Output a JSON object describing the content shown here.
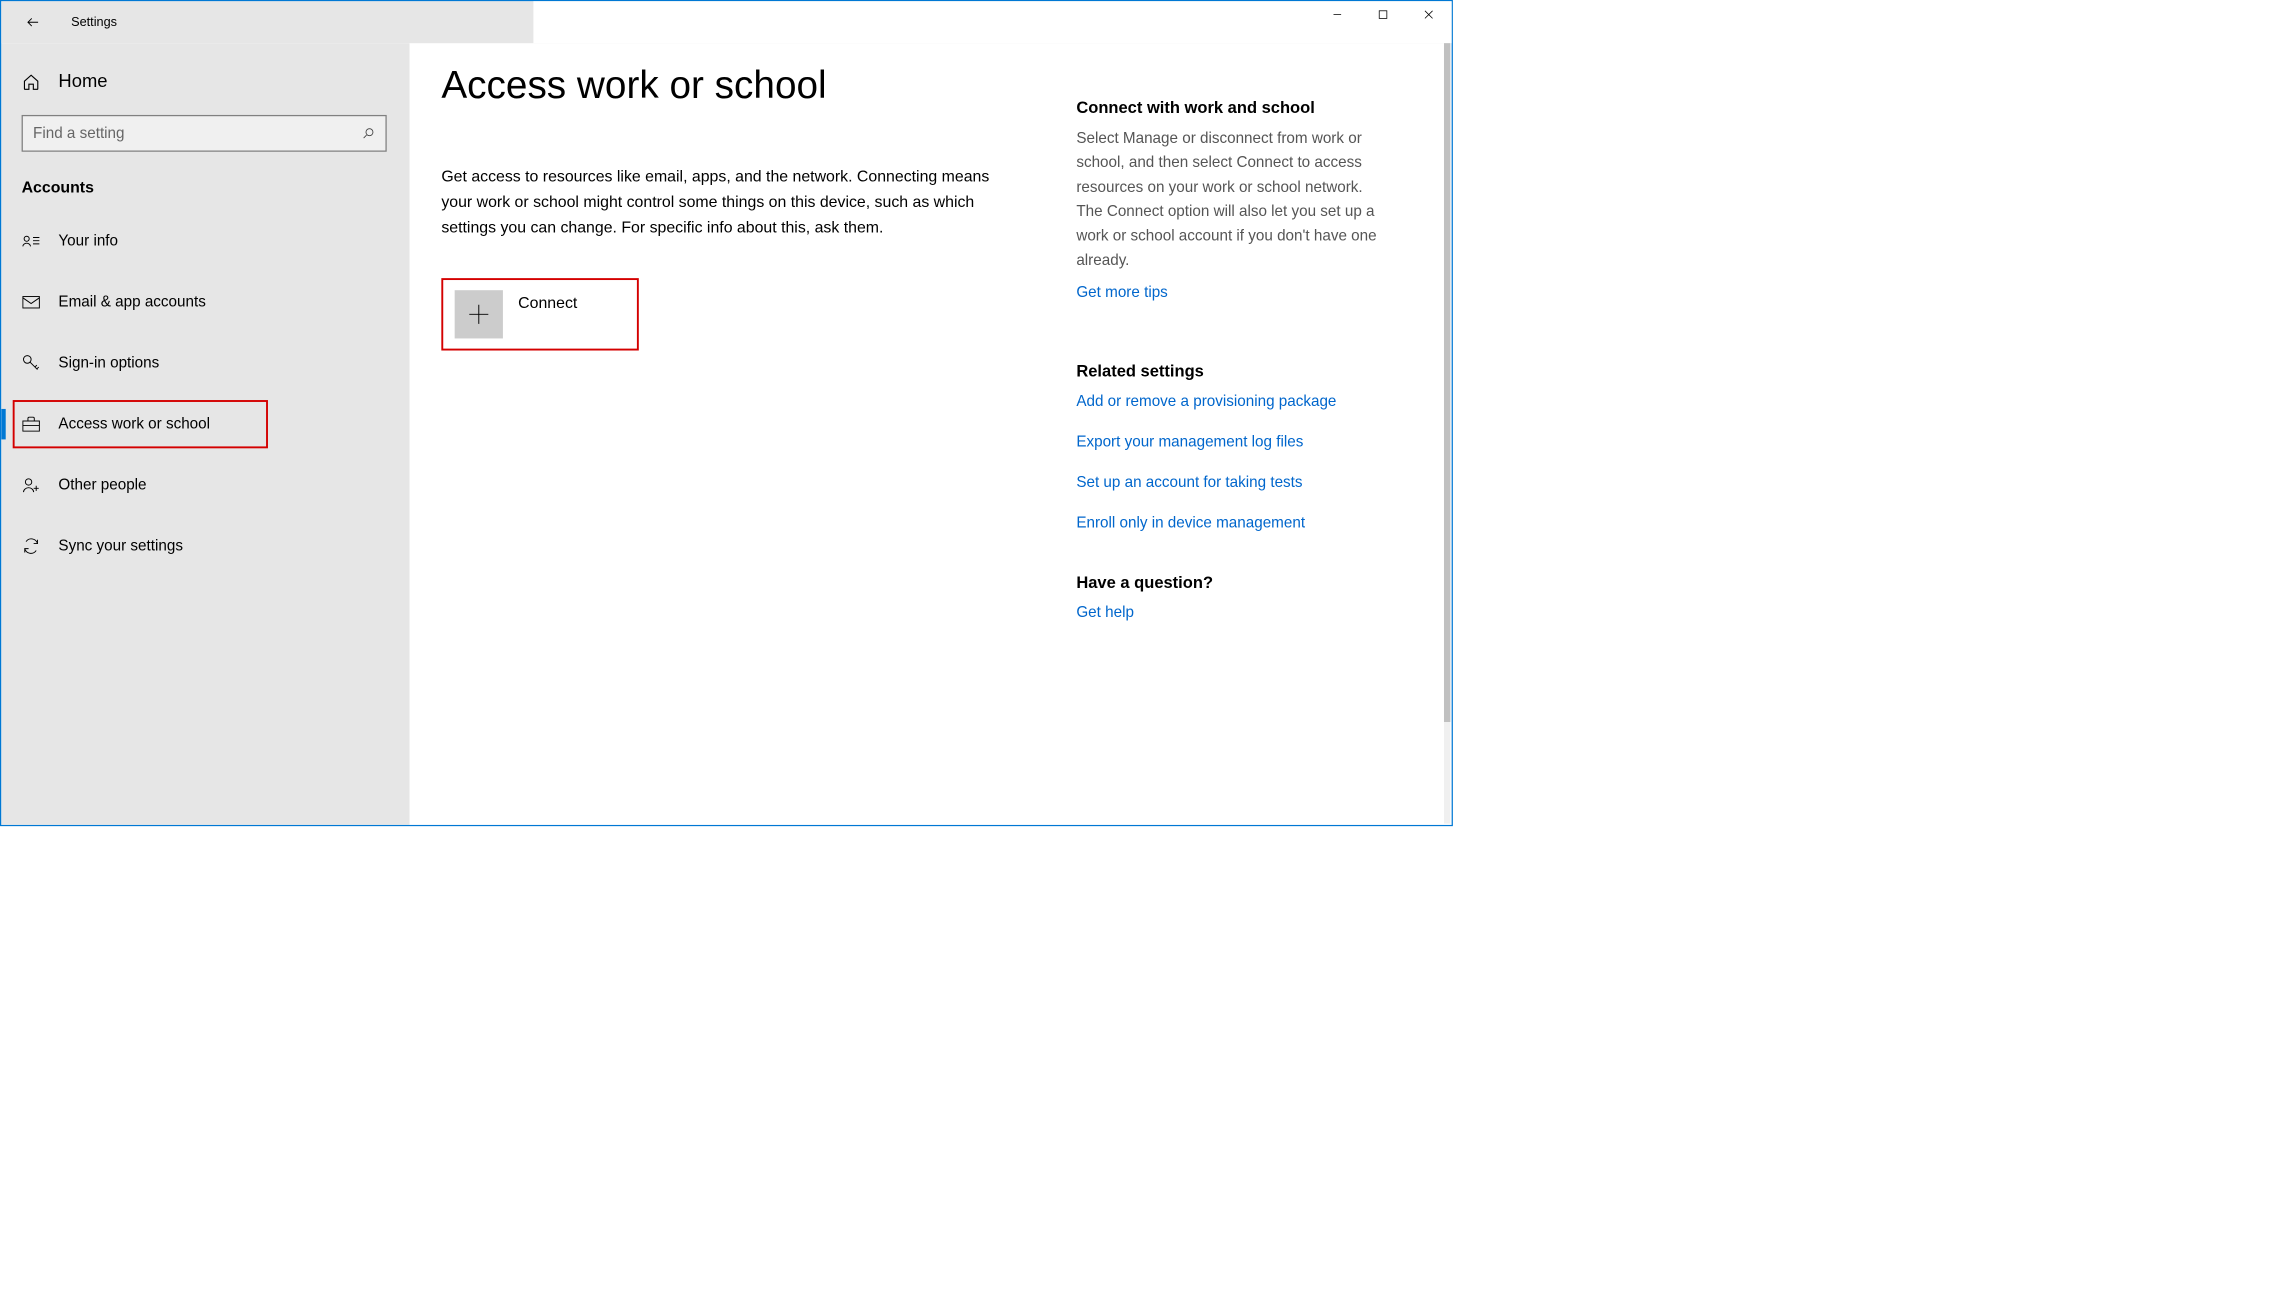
{
  "titlebar": {
    "app_title": "Settings"
  },
  "sidebar": {
    "home_label": "Home",
    "search_placeholder": "Find a setting",
    "category": "Accounts",
    "items": [
      {
        "label": "Your info",
        "icon": "person-card-icon"
      },
      {
        "label": "Email & app accounts",
        "icon": "mail-icon"
      },
      {
        "label": "Sign-in options",
        "icon": "key-icon"
      },
      {
        "label": "Access work or school",
        "icon": "briefcase-icon"
      },
      {
        "label": "Other people",
        "icon": "person-add-icon"
      },
      {
        "label": "Sync your settings",
        "icon": "sync-icon"
      }
    ]
  },
  "main": {
    "title": "Access work or school",
    "description": "Get access to resources like email, apps, and the network. Connecting means your work or school might control some things on this device, such as which settings you can change. For specific info about this, ask them.",
    "connect_label": "Connect"
  },
  "right_panel": {
    "section1": {
      "heading": "Connect with work and school",
      "desc": "Select Manage or disconnect from work or school, and then select Connect to access resources on your work or school network. The Connect option will also let you set up a work or school account if you don't have one already.",
      "link": "Get more tips"
    },
    "section2": {
      "heading": "Related settings",
      "links": [
        "Add or remove a provisioning package",
        "Export your management log files",
        "Set up an account for taking tests",
        "Enroll only in device management"
      ]
    },
    "section3": {
      "heading": "Have a question?",
      "link": "Get help"
    }
  }
}
